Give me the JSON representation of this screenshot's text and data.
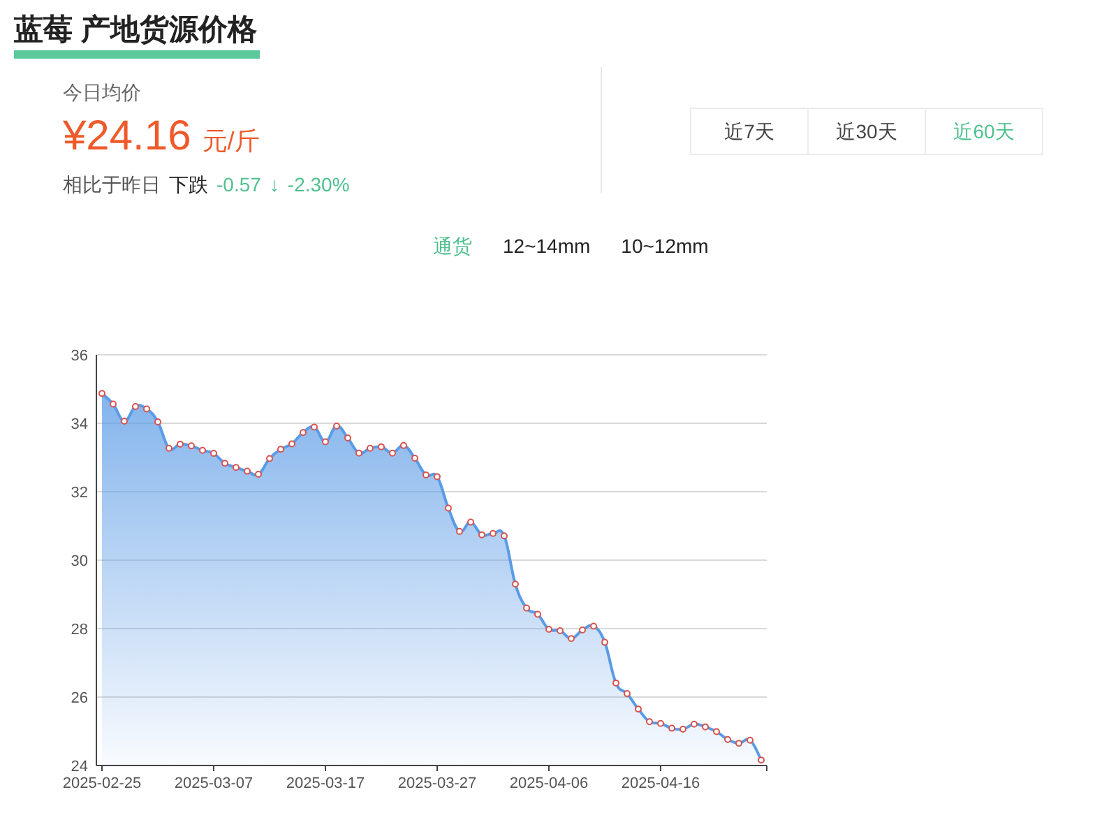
{
  "title": "蓝莓 产地货源价格",
  "today": {
    "label": "今日均价",
    "price": "¥24.16",
    "unit": "元/斤",
    "compare_label": "相比于昨日",
    "trend": "下跌",
    "change": "-0.57",
    "arrow": "↓",
    "percent": "-2.30%"
  },
  "ranges": [
    {
      "label": "近7天",
      "selected": false
    },
    {
      "label": "近30天",
      "selected": false
    },
    {
      "label": "近60天",
      "selected": true
    }
  ],
  "grades": [
    {
      "label": "通货",
      "selected": true
    },
    {
      "label": "12~14mm",
      "selected": false
    },
    {
      "label": "10~12mm",
      "selected": false
    }
  ],
  "chart_data": {
    "type": "area",
    "categories": [
      "2025-02-25",
      null,
      null,
      null,
      null,
      null,
      null,
      null,
      null,
      null,
      "2025-03-07",
      null,
      null,
      null,
      null,
      null,
      null,
      null,
      null,
      null,
      "2025-03-17",
      null,
      null,
      null,
      null,
      null,
      null,
      null,
      null,
      null,
      "2025-03-27",
      null,
      null,
      null,
      null,
      null,
      null,
      null,
      null,
      null,
      "2025-04-06",
      null,
      null,
      null,
      null,
      null,
      null,
      null,
      null,
      null,
      "2025-04-16",
      null,
      null,
      null,
      null,
      null,
      null,
      null,
      null,
      null
    ],
    "series": [
      {
        "color": "#5a9be6",
        "values": [
          34.87,
          34.56,
          34.06,
          34.49,
          34.42,
          34.04,
          33.27,
          33.39,
          33.34,
          33.21,
          33.12,
          32.83,
          32.71,
          32.6,
          32.51,
          32.97,
          33.24,
          33.4,
          33.73,
          33.89,
          33.46,
          33.92,
          33.57,
          33.13,
          33.27,
          33.31,
          33.13,
          33.35,
          32.98,
          32.49,
          32.44,
          31.52,
          30.84,
          31.11,
          30.74,
          30.78,
          30.71,
          29.3,
          28.6,
          28.42,
          27.98,
          27.94,
          27.71,
          27.96,
          28.07,
          27.6,
          26.41,
          26.1,
          25.65,
          25.28,
          25.23,
          25.09,
          25.06,
          25.21,
          25.13,
          24.99,
          24.76,
          24.65,
          24.74,
          24.16
        ]
      }
    ],
    "grid": true,
    "ylim": [
      24,
      36
    ],
    "yticks": [
      24,
      26,
      28,
      30,
      32,
      34,
      36
    ]
  }
}
